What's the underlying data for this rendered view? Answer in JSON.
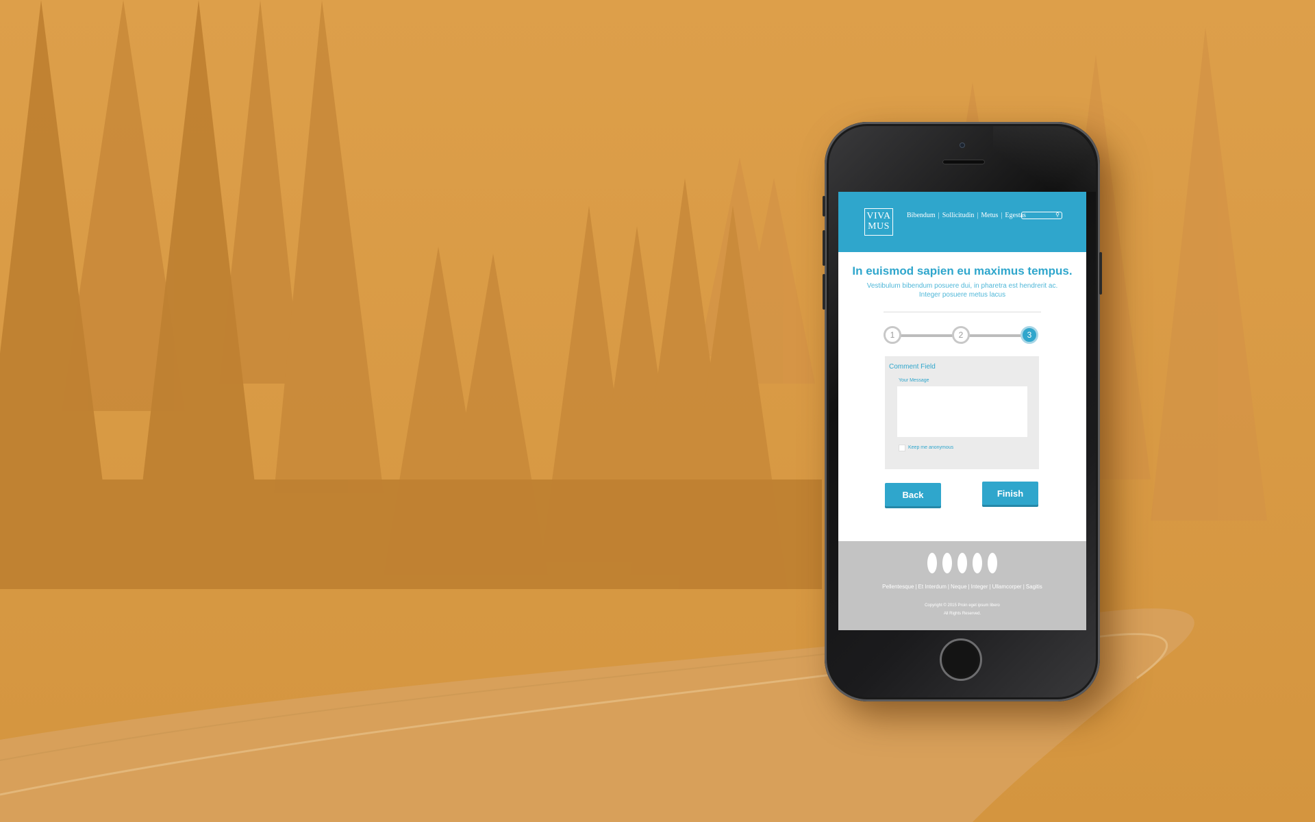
{
  "header": {
    "logo_line1": "VIVA",
    "logo_line2": "MUS",
    "nav": [
      "Bibendum",
      "Sollicitudin",
      "Metus",
      "Egestas"
    ],
    "nav_separator": "|"
  },
  "hero": {
    "title": "In euismod sapien eu maximus tempus.",
    "subtitle": "Vestibulum bibendum posuere dui, in pharetra est hendrerit ac. Integer posuere metus lacus"
  },
  "steps": {
    "labels": [
      "1",
      "2",
      "3"
    ],
    "active": 3
  },
  "form": {
    "title": "Comment Field",
    "message_label": "Your Message",
    "message_value": "",
    "anonymous_label": "Keep me anonymous",
    "anonymous_checked": false
  },
  "buttons": {
    "back": "Back",
    "finish": "Finish"
  },
  "footer": {
    "links": [
      "Pellentesque",
      "Et Interdum",
      "Neque",
      "Integer",
      "Ullamcorper",
      "Sagitis"
    ],
    "copyright_line1": "Copyright © 2015 Proin eget ipsum libero",
    "copyright_line2": "All Rights Reserved."
  },
  "colors": {
    "background": "#d99a45",
    "brand": "#2fa6cc",
    "footer": "#c3c3c3"
  },
  "icons": [
    "search-icon",
    "social-icon"
  ]
}
